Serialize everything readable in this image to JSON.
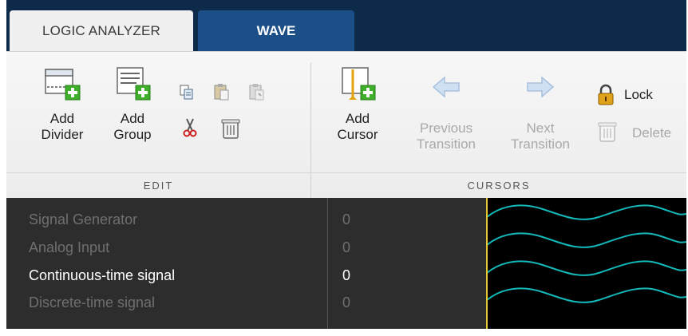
{
  "tabs": [
    {
      "label": "LOGIC ANALYZER",
      "active": true
    },
    {
      "label": "WAVE",
      "active": false
    }
  ],
  "toolstrip": {
    "edit": {
      "section_label": "EDIT",
      "add_divider_label": "Add\nDivider",
      "add_group_label": "Add\nGroup"
    },
    "cursors": {
      "section_label": "CURSORS",
      "add_cursor_label": "Add\nCursor",
      "previous_transition_label": "Previous\nTransition",
      "next_transition_label": "Next\nTransition",
      "lock_label": "Lock",
      "delete_label": "Delete"
    }
  },
  "signals": [
    {
      "name": "Signal Generator",
      "value": "0",
      "active": false
    },
    {
      "name": "Analog Input",
      "value": "0",
      "active": false
    },
    {
      "name": "Continuous-time signal",
      "value": "0",
      "active": true
    },
    {
      "name": "Discrete-time signal",
      "value": "0",
      "active": false
    }
  ],
  "colors": {
    "tab_strip_bg": "#0d2a4a",
    "inactive_tab_bg": "#1c4f88",
    "wave_color": "#14b8b8",
    "cursor_color": "#e6c830",
    "pane_bg": "#2d2d2d"
  },
  "icons": [
    "add-divider-icon",
    "add-group-icon",
    "copy-icon",
    "paste-icon",
    "paste-disabled-icon",
    "cut-icon",
    "delete-icon",
    "add-cursor-icon",
    "previous-transition-icon",
    "next-transition-icon",
    "lock-icon",
    "delete-cursor-icon"
  ]
}
